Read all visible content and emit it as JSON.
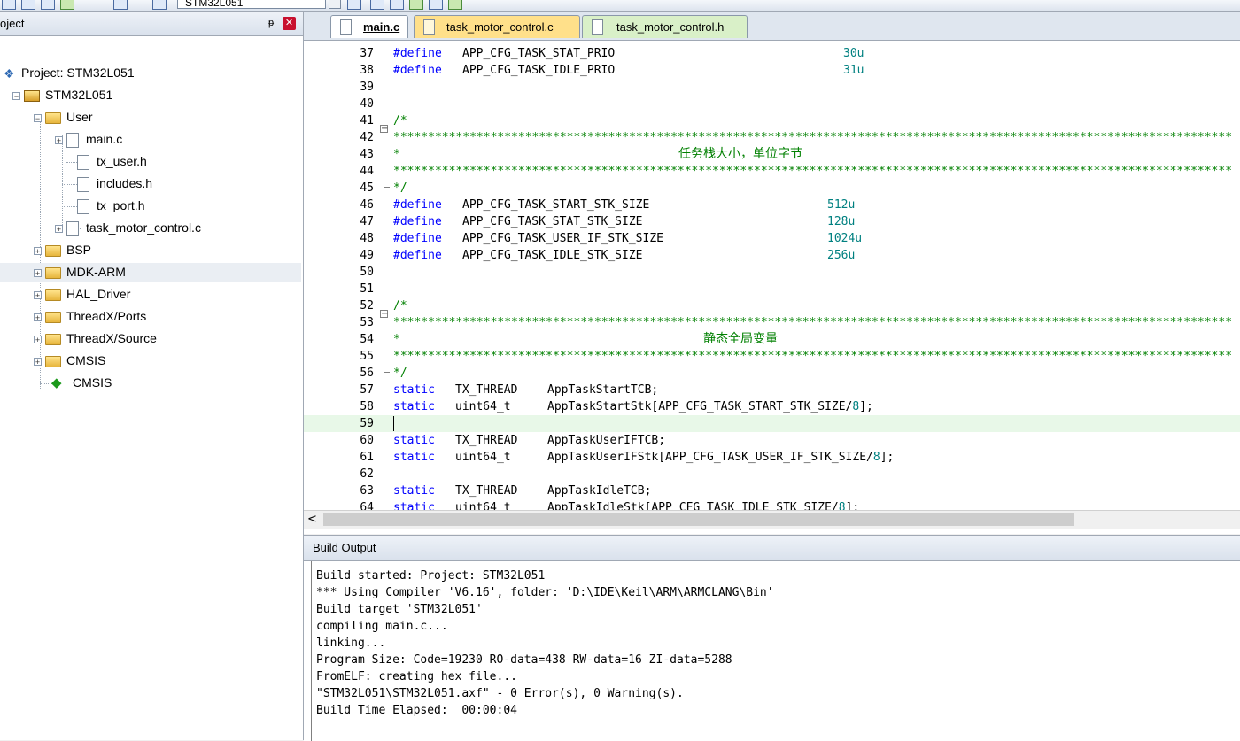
{
  "toolbar": {
    "target": "STM32L051"
  },
  "project_panel": {
    "title": "oject",
    "pin": "ᵽ",
    "close": "✕",
    "tree": {
      "root": "Project: STM32L051",
      "target": "STM32L051",
      "user_folder": "User",
      "user_files": [
        "main.c",
        "tx_user.h",
        "includes.h",
        "tx_port.h",
        "task_motor_control.c"
      ],
      "groups": [
        "BSP",
        "MDK-ARM",
        "HAL_Driver",
        "ThreadX/Ports",
        "ThreadX/Source",
        "CMSIS"
      ],
      "cmsis_component": "CMSIS"
    }
  },
  "tabs": [
    {
      "label": "main.c",
      "active": true
    },
    {
      "label": "task_motor_control.c",
      "active": false
    },
    {
      "label": "task_motor_control.h",
      "active": false
    }
  ],
  "code": {
    "stars": "*************************************************************************************************************************",
    "lines": [
      {
        "n": "37",
        "directive": "#define",
        "name": "APP_CFG_TASK_STAT_PRIO",
        "value": "30u"
      },
      {
        "n": "38",
        "directive": "#define",
        "name": "APP_CFG_TASK_IDLE_PRIO",
        "value": "31u"
      },
      {
        "n": "39"
      },
      {
        "n": "40"
      },
      {
        "n": "41",
        "comment": "/*"
      },
      {
        "n": "42"
      },
      {
        "n": "43",
        "comment": "*",
        "heading": "任务栈大小，单位字节"
      },
      {
        "n": "44"
      },
      {
        "n": "45",
        "comment": "*/"
      },
      {
        "n": "46",
        "directive": "#define",
        "name": "APP_CFG_TASK_START_STK_SIZE",
        "value": "512u"
      },
      {
        "n": "47",
        "directive": "#define",
        "name": "APP_CFG_TASK_STAT_STK_SIZE",
        "value": "128u"
      },
      {
        "n": "48",
        "directive": "#define",
        "name": "APP_CFG_TASK_USER_IF_STK_SIZE",
        "value": "1024u"
      },
      {
        "n": "49",
        "directive": "#define",
        "name": "APP_CFG_TASK_IDLE_STK_SIZE",
        "value": "256u"
      },
      {
        "n": "50"
      },
      {
        "n": "51"
      },
      {
        "n": "52",
        "comment": "/*"
      },
      {
        "n": "53"
      },
      {
        "n": "54",
        "comment": "*",
        "heading": "静态全局变量"
      },
      {
        "n": "55"
      },
      {
        "n": "56",
        "comment": "*/"
      },
      {
        "n": "57",
        "kw": "static",
        "type": "TX_THREAD",
        "decl": "AppTaskStartTCB;"
      },
      {
        "n": "58",
        "kw": "static",
        "type": "uint64_t",
        "decl_pre": "AppTaskStartStk[APP_CFG_TASK_START_STK_SIZE/",
        "decl_num": "8",
        "decl_post": "];"
      },
      {
        "n": "59"
      },
      {
        "n": "60",
        "kw": "static",
        "type": "TX_THREAD",
        "decl": "AppTaskUserIFTCB;"
      },
      {
        "n": "61",
        "kw": "static",
        "type": "uint64_t",
        "decl_pre": "AppTaskUserIFStk[APP_CFG_TASK_USER_IF_STK_SIZE/",
        "decl_num": "8",
        "decl_post": "];"
      },
      {
        "n": "62"
      },
      {
        "n": "63",
        "kw": "static",
        "type": "TX_THREAD",
        "decl": "AppTaskIdleTCB;"
      },
      {
        "n": "64",
        "kw": "static",
        "type": "uint64_t",
        "decl_pre": "AppTaskIdleStk[APP_CFG_TASK_IDLE_STK_SIZE/",
        "decl_num": "8",
        "decl_post": "];"
      }
    ]
  },
  "scrollbar": {
    "left_arrow": "<"
  },
  "build_output": {
    "title": "Build Output",
    "lines": [
      "Build started: Project: STM32L051",
      "*** Using Compiler 'V6.16', folder: 'D:\\IDE\\Keil\\ARM\\ARMCLANG\\Bin'",
      "Build target 'STM32L051'",
      "compiling main.c...",
      "linking...",
      "Program Size: Code=19230 RO-data=438 RW-data=16 ZI-data=5288",
      "FromELF: creating hex file...",
      "\"STM32L051\\STM32L051.axf\" - 0 Error(s), 0 Warning(s).",
      "Build Time Elapsed:  00:00:04"
    ]
  }
}
